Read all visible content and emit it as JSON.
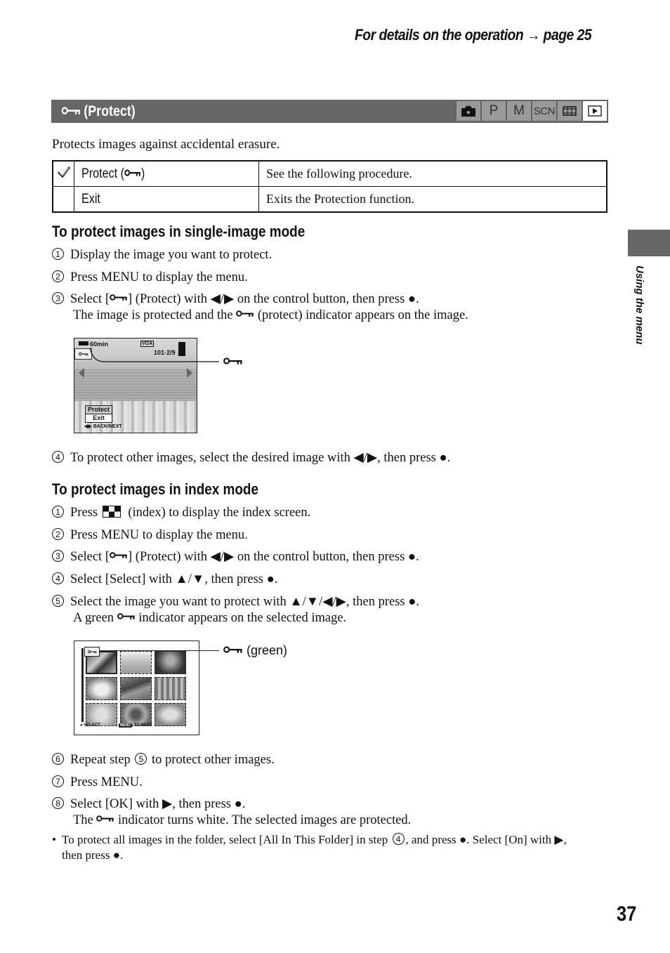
{
  "header": {
    "page_ref": "For details on the operation → page 25"
  },
  "title_bar": {
    "icon": "protect-key-icon",
    "title": "(Protect)",
    "modes": [
      {
        "icon": "camera-auto-icon",
        "label": "",
        "active": false
      },
      {
        "icon": "program-icon",
        "label": "P",
        "active": false
      },
      {
        "icon": "manual-icon",
        "label": "M",
        "active": false
      },
      {
        "icon": "scene-icon",
        "label": "SCN",
        "active": false
      },
      {
        "icon": "movie-icon",
        "label": "",
        "active": false
      },
      {
        "icon": "playback-icon",
        "label": "",
        "active": true
      }
    ]
  },
  "intro": "Protects images against accidental erasure.",
  "options_table": {
    "rows": [
      {
        "default": true,
        "label": "Protect (",
        "label_suffix": ")",
        "description": "See the following procedure."
      },
      {
        "default": false,
        "label": "Exit",
        "label_suffix": "",
        "description": "Exits the Protection function."
      }
    ]
  },
  "section_single": {
    "heading": "To protect images in single-image mode",
    "steps": [
      {
        "num": "1",
        "text": "Display the image you want to protect."
      },
      {
        "num": "2",
        "text": "Press MENU to display the menu."
      },
      {
        "num": "3",
        "text_a": "Select [",
        "text_b": "] (Protect) with ◀/▶ on the control button, then press ●.",
        "sub_a": "The image is protected and the ",
        "sub_b": " (protect) indicator appears on the image."
      },
      {
        "num": "4",
        "text": "To protect other images, select the desired image with ◀/▶, then press ●."
      }
    ],
    "screen": {
      "remaining": "60min",
      "size": "VGA",
      "folder_count": "101·2/9",
      "menu_items": [
        "Protect",
        "Exit"
      ],
      "footer": "◀▶ BACK/NEXT"
    },
    "callout": ""
  },
  "section_index": {
    "heading": "To protect images in index mode",
    "steps": [
      {
        "num": "1",
        "text_a": "Press ",
        "text_b": " (index) to display the index screen."
      },
      {
        "num": "2",
        "text": "Press MENU to display the menu."
      },
      {
        "num": "3",
        "text_a": "Select [",
        "text_b": "] (Protect) with ◀/▶ on the control button, then press ●."
      },
      {
        "num": "4",
        "text": "Select [Select] with ▲/▼, then press ●."
      },
      {
        "num": "5",
        "text": "Select the image you want to protect with ▲/▼/◀/▶, then press ●.",
        "sub_a": "A green ",
        "sub_b": " indicator appears on the selected image."
      },
      {
        "num": "6",
        "text_a": "Repeat step ",
        "ref": "5",
        "text_b": " to protect other images."
      },
      {
        "num": "7",
        "text": "Press MENU."
      },
      {
        "num": "8",
        "text": "Select [OK] with ▶, then press ●.",
        "sub_a": "The ",
        "sub_b": " indicator turns white. The selected images are protected."
      }
    ],
    "screen": {
      "footer_select": "● SELECT",
      "footer_menu": "MENU",
      "footer_next": "TO NEXT"
    },
    "callout": "(green)"
  },
  "note": {
    "text_a": "To protect all images in the folder, select [All In This Folder] in step ",
    "ref": "4",
    "text_b": ", and press ●. Select [On] with ▶,",
    "text_c": "then press ●."
  },
  "side_tab": "Using the menu",
  "page_number": "37"
}
